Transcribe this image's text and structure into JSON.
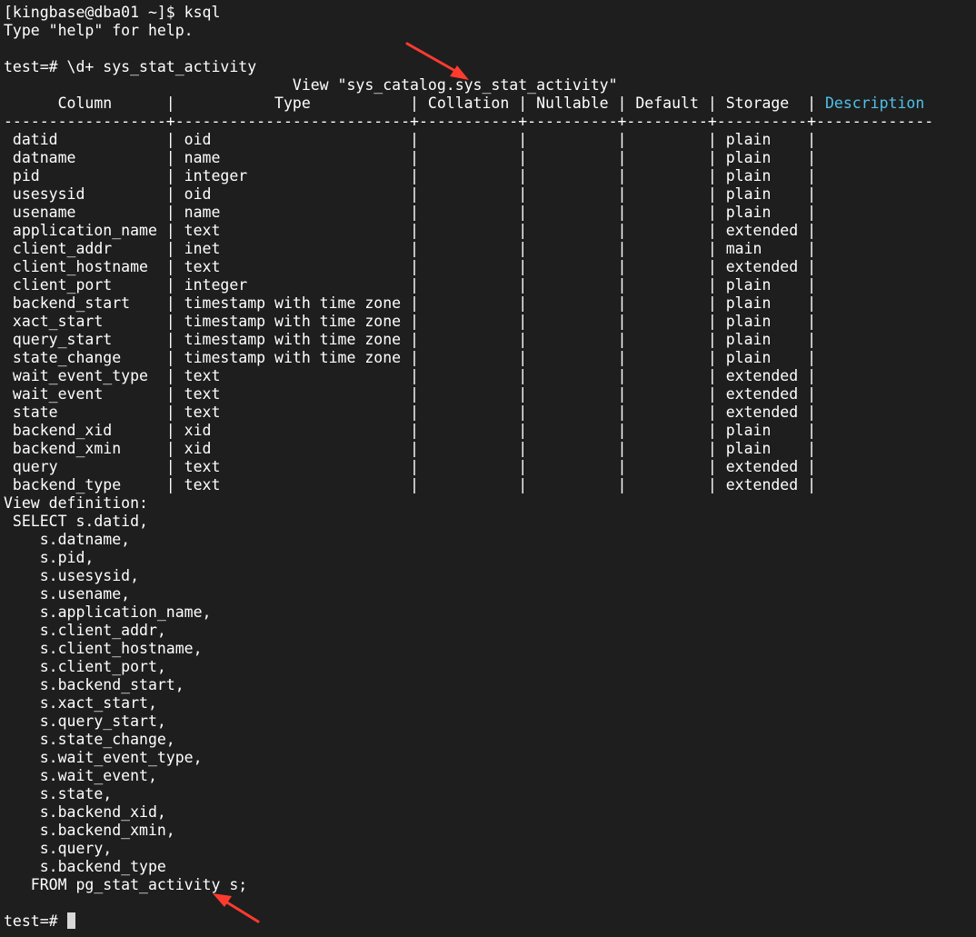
{
  "terminal": {
    "lines": [
      "[kingbase@dba01 ~]$ ksql",
      "Type \"help\" for help.",
      "",
      "test=# \\d+ sys_stat_activity",
      "                                View \"sys_catalog.sys_stat_activity\"",
      "      Column      |           Type           | Collation | Nullable | Default | Storage  | ",
      "------------------+--------------------------+-----------+----------+---------+----------+-------------",
      " datid            | oid                      |           |          |         | plain    |",
      " datname          | name                     |           |          |         | plain    |",
      " pid              | integer                  |           |          |         | plain    |",
      " usesysid         | oid                      |           |          |         | plain    |",
      " usename          | name                     |           |          |         | plain    |",
      " application_name | text                     |           |          |         | extended |",
      " client_addr      | inet                     |           |          |         | main     |",
      " client_hostname  | text                     |           |          |         | extended |",
      " client_port      | integer                  |           |          |         | plain    |",
      " backend_start    | timestamp with time zone |           |          |         | plain    |",
      " xact_start       | timestamp with time zone |           |          |         | plain    |",
      " query_start      | timestamp with time zone |           |          |         | plain    |",
      " state_change     | timestamp with time zone |           |          |         | plain    |",
      " wait_event_type  | text                     |           |          |         | extended |",
      " wait_event       | text                     |           |          |         | extended |",
      " state            | text                     |           |          |         | extended |",
      " backend_xid      | xid                      |           |          |         | plain    |",
      " backend_xmin     | xid                      |           |          |         | plain    |",
      " query            | text                     |           |          |         | extended |",
      " backend_type     | text                     |           |          |         | extended |",
      "View definition:",
      " SELECT s.datid,",
      "    s.datname,",
      "    s.pid,",
      "    s.usesysid,",
      "    s.usename,",
      "    s.application_name,",
      "    s.client_addr,",
      "    s.client_hostname,",
      "    s.client_port,",
      "    s.backend_start,",
      "    s.xact_start,",
      "    s.query_start,",
      "    s.state_change,",
      "    s.wait_event_type,",
      "    s.wait_event,",
      "    s.state,",
      "    s.backend_xid,",
      "    s.backend_xmin,",
      "    s.query,",
      "    s.backend_type",
      "   FROM pg_stat_activity s;",
      "",
      "test=# "
    ],
    "description_header": "Description",
    "colors": {
      "background": "#1e1e1e",
      "foreground": "#ffffff",
      "highlight": "#4fc1e9",
      "annotation_arrow": "#ff3b30",
      "cursor": "#d8d8d8"
    },
    "icons": [
      "red-annotation-arrow",
      "terminal-cursor"
    ]
  }
}
